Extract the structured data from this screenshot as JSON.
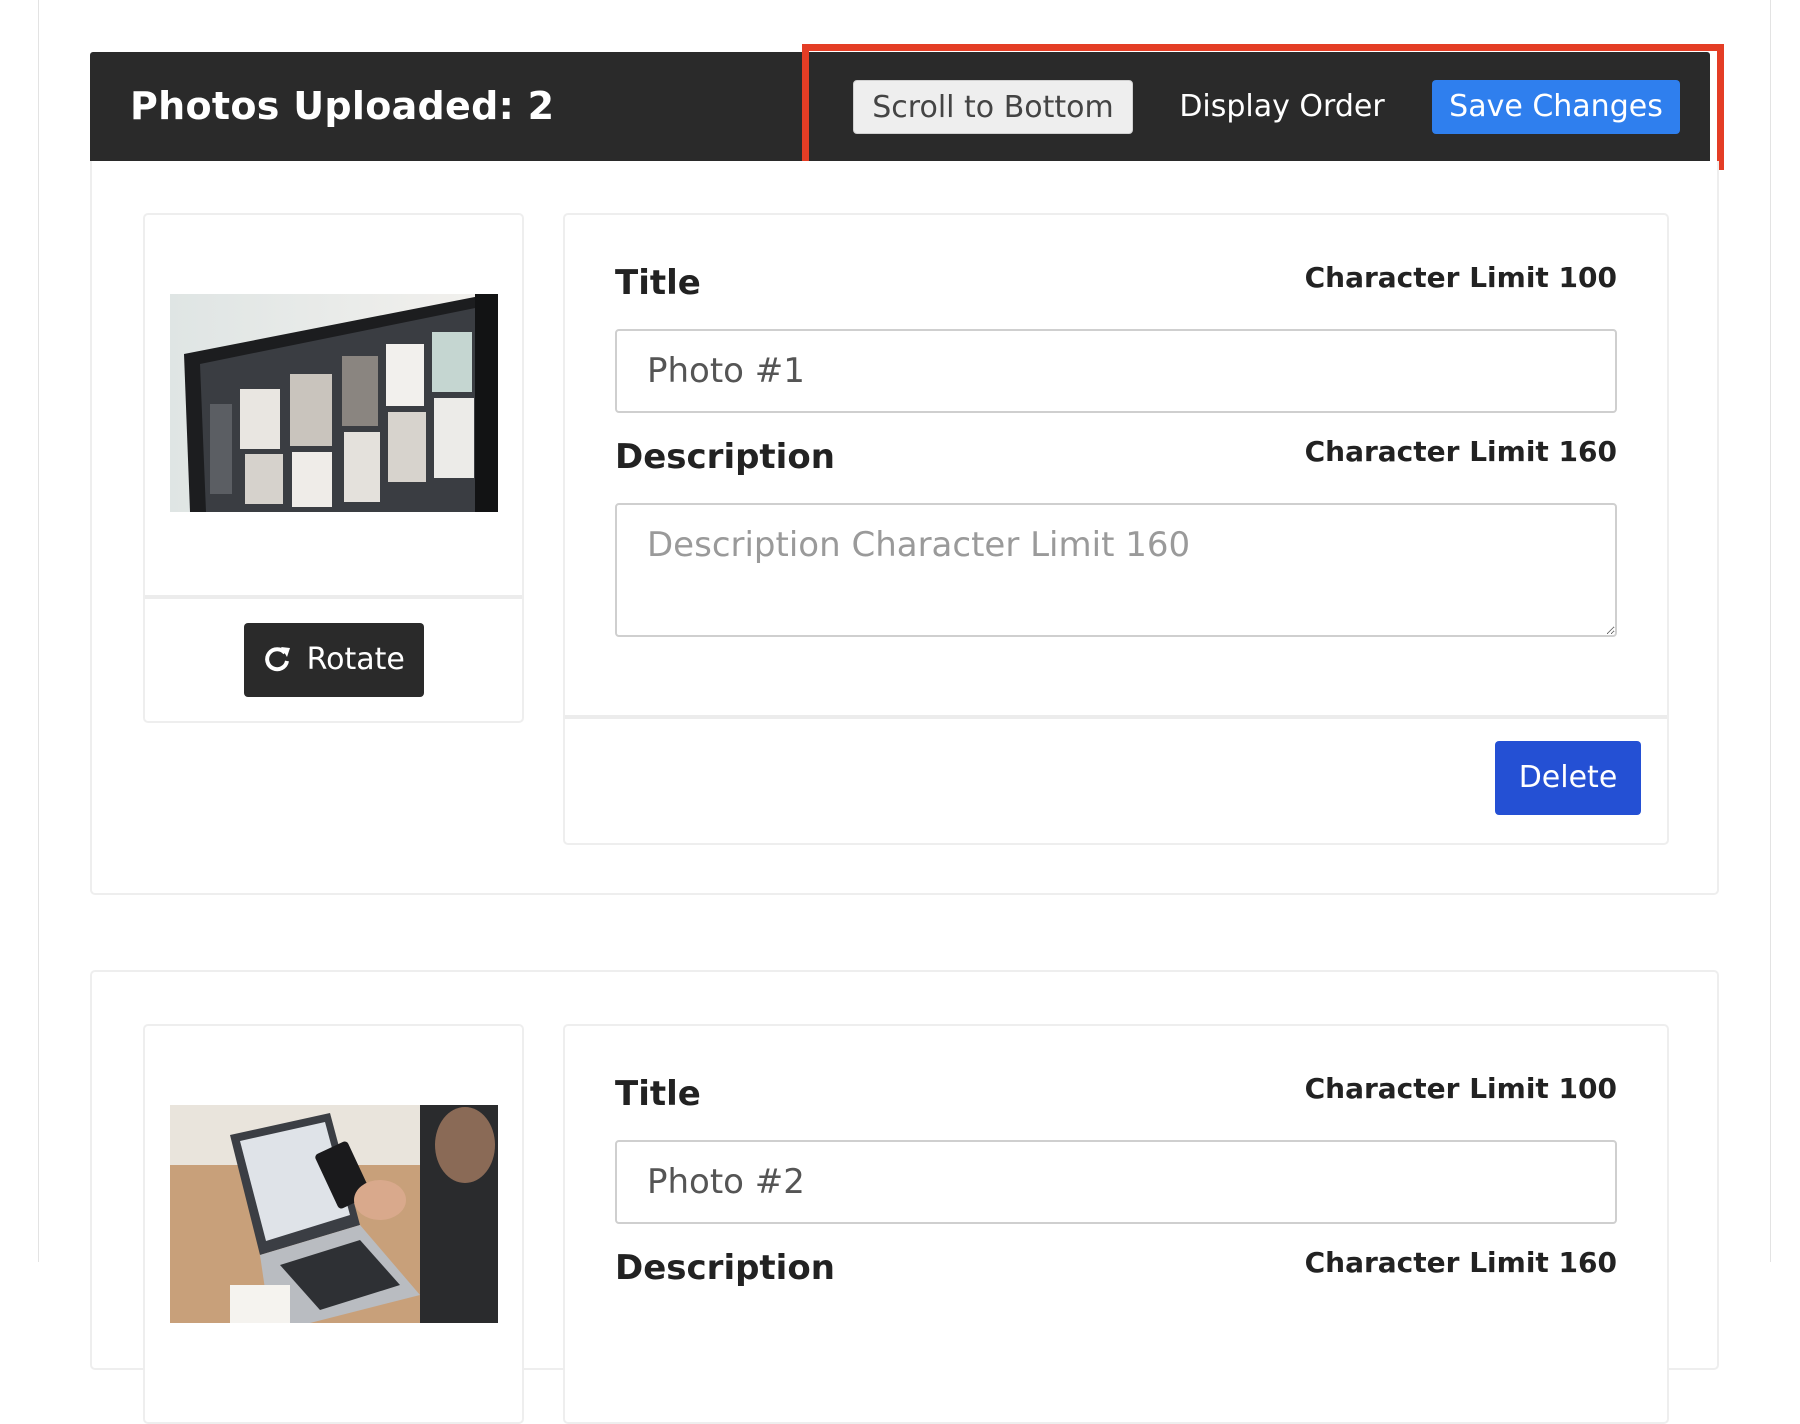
{
  "header": {
    "title": "Photos Uploaded: 2",
    "scroll_label": "Scroll to Bottom",
    "order_label": "Display Order",
    "save_label": "Save Changes"
  },
  "photos": [
    {
      "rotate_label": "Rotate",
      "title_label": "Title",
      "title_limit": "Character Limit 100",
      "title_value": "Photo #1",
      "description_label": "Description",
      "description_limit": "Character Limit 160",
      "description_placeholder": "Description Character Limit 160",
      "delete_label": "Delete",
      "image_subject": "computer monitor showing photo gallery"
    },
    {
      "title_label": "Title",
      "title_limit": "Character Limit 100",
      "title_value": "Photo #2",
      "description_label": "Description",
      "description_limit": "Character Limit 160",
      "image_subject": "person using laptop and smartphone"
    }
  ],
  "colors": {
    "header_bg": "#2a2a2a",
    "save_button": "#2f7fee",
    "delete_button": "#2450d4",
    "highlight": "#e43d25"
  }
}
